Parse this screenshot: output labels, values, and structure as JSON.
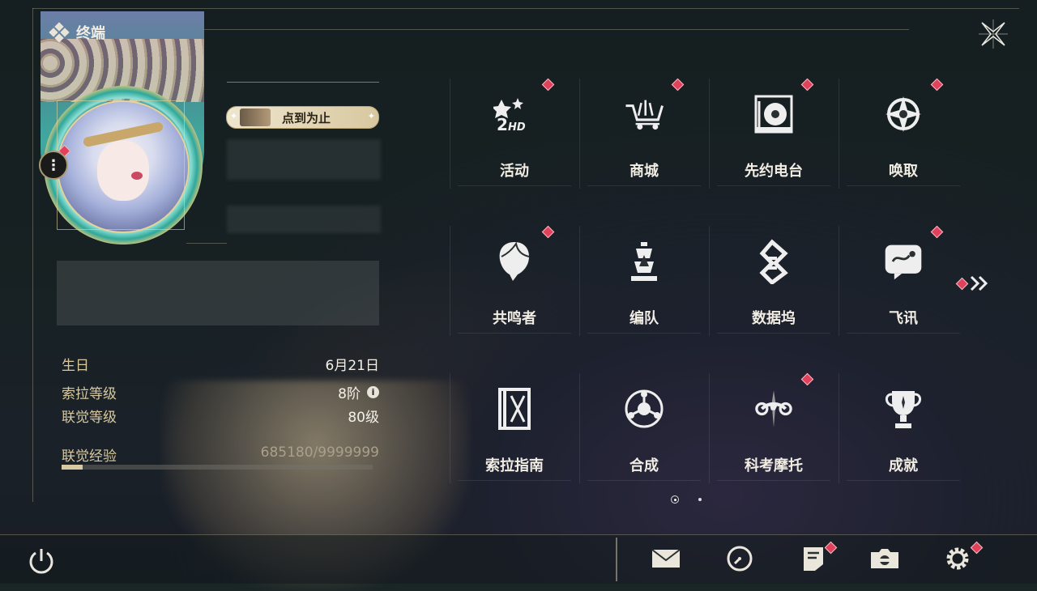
{
  "header": {
    "title": "终端"
  },
  "profile": {
    "badge_title": "点到为止",
    "stats": [
      {
        "key": "生日",
        "value": "6月21日"
      },
      {
        "key": "索拉等级",
        "value": "8阶"
      },
      {
        "key": "联觉等级",
        "value": "80级"
      }
    ],
    "exp": {
      "label": "联觉经验",
      "value": "685180/9999999",
      "progress": 0.0685
    }
  },
  "menu": {
    "tiles": [
      {
        "label": "活动",
        "icon": "event-2hd-icon",
        "badge": true
      },
      {
        "label": "商城",
        "icon": "shop-cart-icon",
        "badge": true
      },
      {
        "label": "先约电台",
        "icon": "radio-icon",
        "badge": true
      },
      {
        "label": "唤取",
        "icon": "summon-compass-icon",
        "badge": true
      },
      {
        "label": "共鸣者",
        "icon": "resonator-head-icon",
        "badge": true
      },
      {
        "label": "编队",
        "icon": "team-chess-icon",
        "badge": false
      },
      {
        "label": "数据坞",
        "icon": "databank-icon",
        "badge": false
      },
      {
        "label": "飞讯",
        "icon": "message-icon",
        "badge": true
      },
      {
        "label": "索拉指南",
        "icon": "guide-book-icon",
        "badge": false
      },
      {
        "label": "合成",
        "icon": "synthesis-icon",
        "badge": false
      },
      {
        "label": "科考摩托",
        "icon": "motorbike-icon",
        "badge": true
      },
      {
        "label": "成就",
        "icon": "trophy-icon",
        "badge": false
      }
    ]
  },
  "colors": {
    "accent_gold": "#d8c9a0",
    "badge_red": "#e2415b",
    "teal_ring": "#2fa89a"
  }
}
